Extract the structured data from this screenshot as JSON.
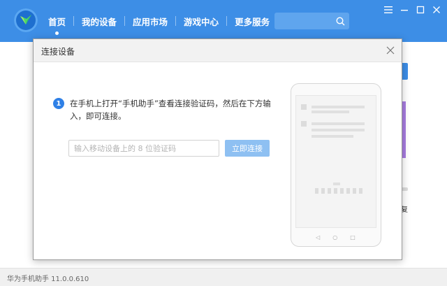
{
  "app": {
    "nav": [
      {
        "label": "首页",
        "active": true
      },
      {
        "label": "我的设备",
        "active": false
      },
      {
        "label": "应用市场",
        "active": false
      },
      {
        "label": "游戏中心",
        "active": false
      },
      {
        "label": "更多服务",
        "active": false
      }
    ],
    "search": {
      "value": "",
      "icon": "search-icon"
    },
    "window_controls": [
      "menu-icon",
      "minimize-icon",
      "maximize-icon",
      "close-icon"
    ],
    "accent_color": "#3d8ee6"
  },
  "background": {
    "partial_text": "复"
  },
  "dialog": {
    "title": "连接设备",
    "step_number": "1",
    "instruction": "在手机上打开“手机助手”查看连接验证码，然后在下方输入，即可连接。",
    "input": {
      "value": "",
      "placeholder": "输入移动设备上的 8 位验证码"
    },
    "connect_label": "立即连接",
    "phone_nav": [
      "◁",
      "○",
      "□"
    ]
  },
  "statusbar": {
    "text": "华为手机助手 11.0.0.610"
  }
}
